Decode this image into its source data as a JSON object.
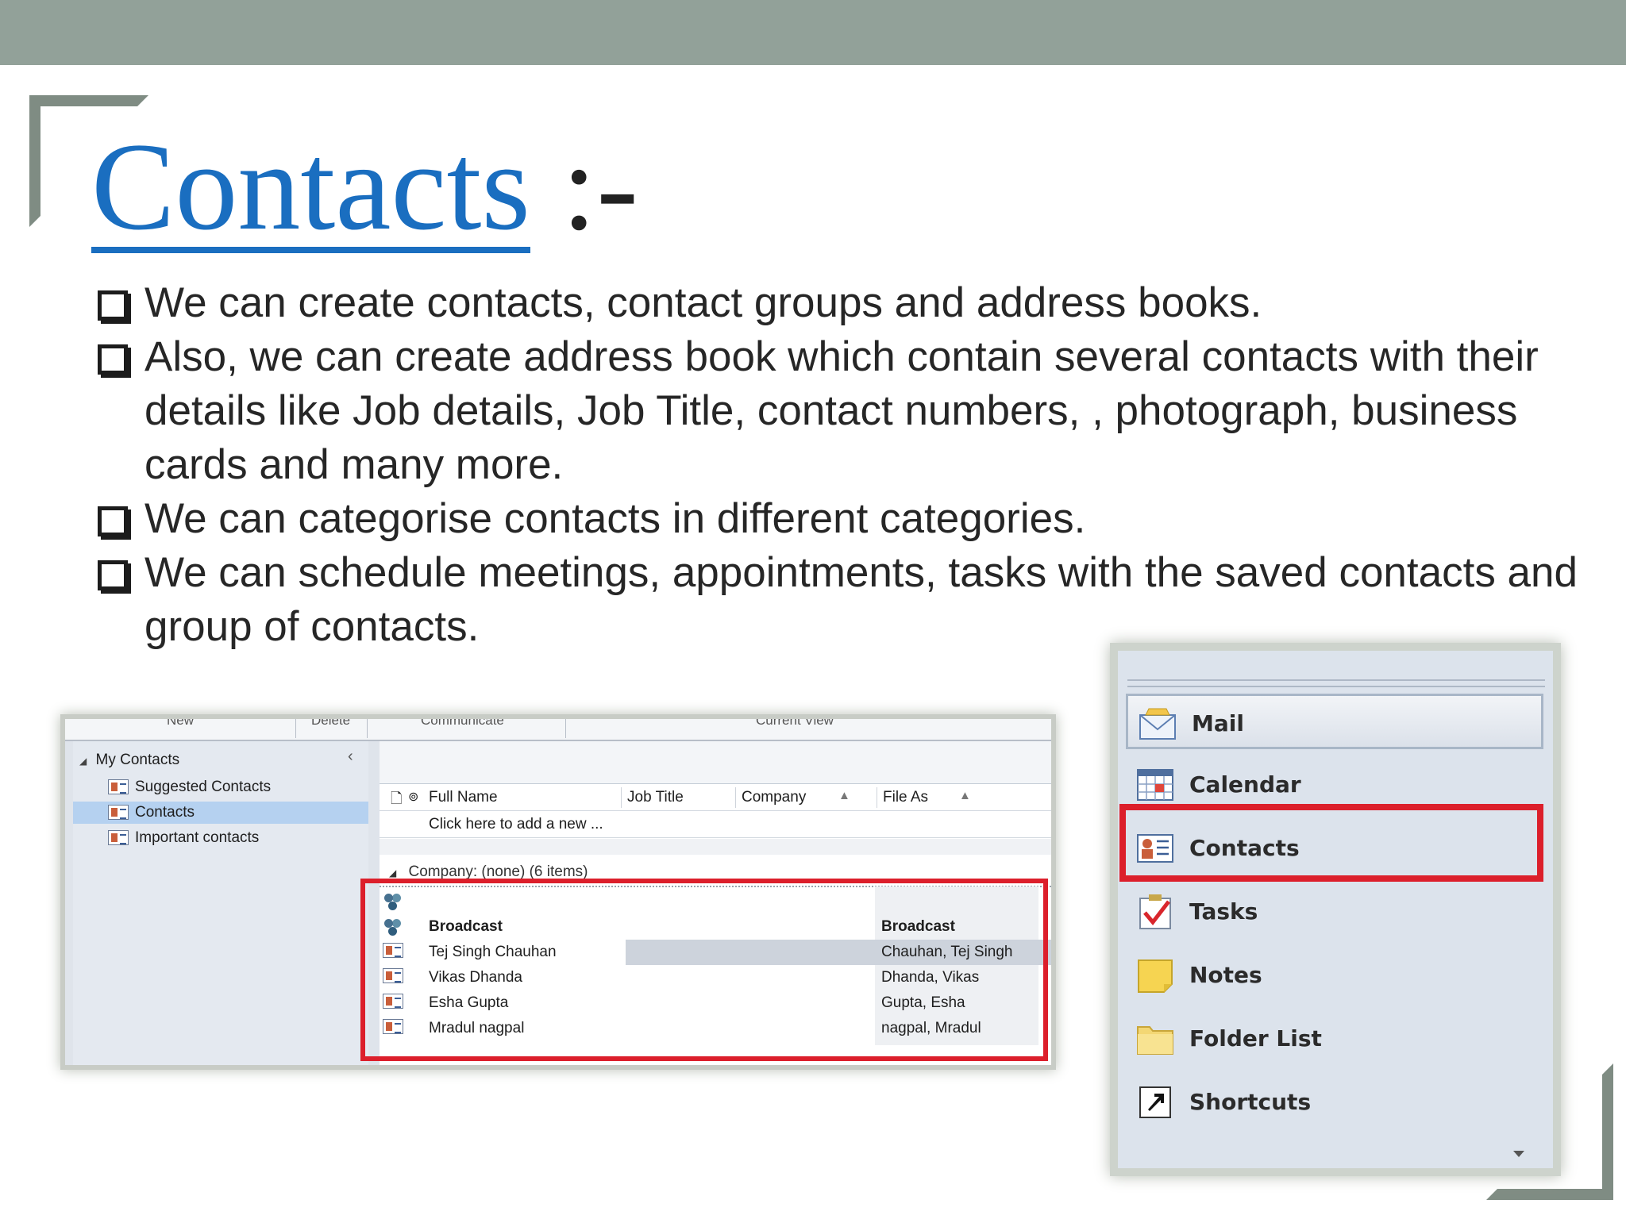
{
  "slide": {
    "title": "Contacts",
    "title_suffix": " :-",
    "bullets": [
      "We can create contacts, contact groups and address books.",
      "Also, we can create address book which contain several contacts with their details like  Job details, Job Title, contact numbers, , photograph, business cards and many more.",
      "We can categorise contacts in different categories.",
      "We can schedule meetings, appointments, tasks with the saved contacts and group of contacts."
    ],
    "colors": {
      "top_bar": "#92a199",
      "title": "#1a6ec0",
      "highlight_box": "#dc1f2b"
    }
  },
  "contacts_screenshot": {
    "ribbon_groups": [
      "New",
      "Delete",
      "Communicate",
      "Current View"
    ],
    "nav": {
      "root": "My Contacts",
      "items": [
        "Suggested Contacts",
        "Contacts",
        "Important contacts"
      ],
      "selected": "Contacts"
    },
    "columns": [
      "Full Name",
      "Job Title",
      "Company",
      "File As"
    ],
    "add_new_placeholder": "Click here to add a new ...",
    "group_header": "Company: (none) (6 items)",
    "rows": [
      {
        "icon": "group-icon",
        "full_name": "",
        "file_as": ""
      },
      {
        "icon": "group-icon",
        "full_name": "Broadcast",
        "file_as": "Broadcast"
      },
      {
        "icon": "contact-card-icon",
        "full_name": "Tej Singh Chauhan",
        "file_as": "Chauhan, Tej Singh"
      },
      {
        "icon": "contact-card-icon",
        "full_name": "Vikas Dhanda",
        "file_as": "Dhanda, Vikas"
      },
      {
        "icon": "contact-card-icon",
        "full_name": "Esha Gupta",
        "file_as": "Gupta, Esha"
      },
      {
        "icon": "contact-card-icon",
        "full_name": "Mradul nagpal",
        "file_as": "nagpal, Mradul"
      }
    ]
  },
  "navigation_pane": {
    "items": [
      {
        "label": "Mail",
        "icon": "mail-icon"
      },
      {
        "label": "Calendar",
        "icon": "calendar-icon"
      },
      {
        "label": "Contacts",
        "icon": "contacts-icon"
      },
      {
        "label": "Tasks",
        "icon": "tasks-icon"
      },
      {
        "label": "Notes",
        "icon": "notes-icon"
      },
      {
        "label": "Folder List",
        "icon": "folder-icon"
      },
      {
        "label": "Shortcuts",
        "icon": "shortcut-icon"
      }
    ],
    "active": "Mail",
    "highlighted": "Contacts"
  }
}
